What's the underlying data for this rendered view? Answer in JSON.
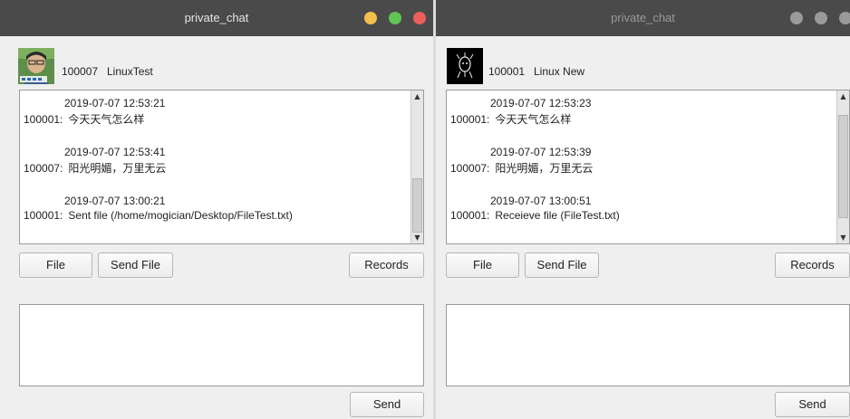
{
  "left_window": {
    "title": "private_chat",
    "header": {
      "id": "100007",
      "name": "LinuxTest"
    },
    "messages": [
      {
        "time": "2019-07-07 12:53:21",
        "sender": "100001:",
        "text": "今天天气怎么样"
      },
      {
        "time": "2019-07-07 12:53:41",
        "sender": "100007:",
        "text": "阳光明媚，万里无云"
      },
      {
        "time": "2019-07-07 13:00:21",
        "sender": "100001:",
        "text": "Sent file (/home/mogician/Desktop/FileTest.txt)"
      }
    ],
    "buttons": {
      "file": "File",
      "send_file": "Send File",
      "records": "Records",
      "send": "Send"
    }
  },
  "right_window": {
    "title": "private_chat",
    "header": {
      "id": "100001",
      "name": "Linux New"
    },
    "messages": [
      {
        "time": "2019-07-07 12:53:23",
        "sender": "100001:",
        "text": "今天天气怎么样"
      },
      {
        "time": "2019-07-07 12:53:39",
        "sender": "100007:",
        "text": "阳光明媚，万里无云"
      },
      {
        "time": "2019-07-07 13:00:51",
        "sender": "100001:",
        "text": "Receieve file (FileTest.txt)"
      }
    ],
    "buttons": {
      "file": "File",
      "send_file": "Send File",
      "records": "Records",
      "send": "Send"
    }
  },
  "colors": {
    "title_bar": "#4a4a4a",
    "window_bg": "#efefef",
    "minimize": "#f5bf4f",
    "maximize": "#61c454",
    "close": "#ec5f5d",
    "inactive_button": "#9a9a9a"
  },
  "icons": {
    "left_avatar": "user-photo-avatar",
    "right_avatar": "black-sketch-avatar",
    "scroll_up": "triangle-up-icon",
    "scroll_down": "triangle-down-icon"
  }
}
